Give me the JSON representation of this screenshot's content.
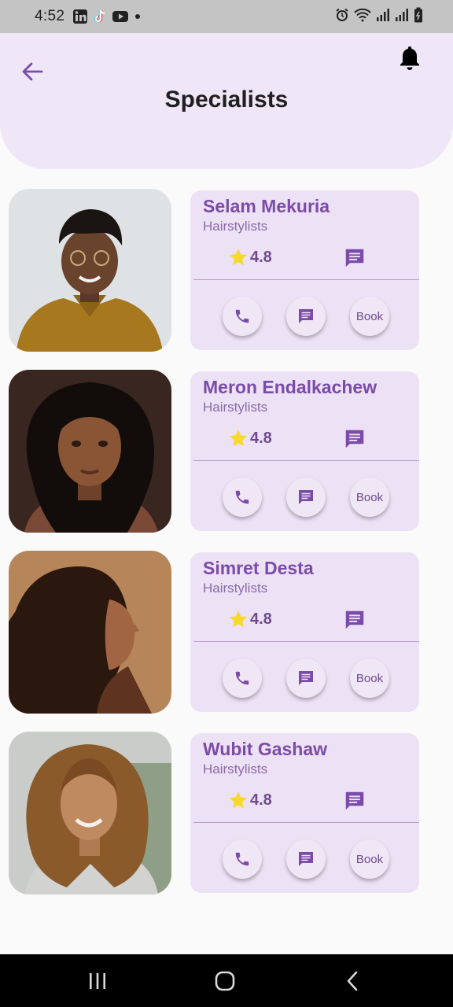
{
  "status_bar": {
    "time": "4:52",
    "left_icons": [
      "linkedin-icon",
      "tiktok-icon",
      "youtube-icon",
      "dot-icon"
    ],
    "right_icons": [
      "alarm-icon",
      "wifi-icon",
      "signal-icon",
      "signal-icon",
      "battery-icon"
    ]
  },
  "header": {
    "title": "Specialists",
    "back_icon": "arrow-left-icon",
    "notifications_icon": "bell-icon"
  },
  "specialists": [
    {
      "name": "Selam Mekuria",
      "role": "Hairstylists",
      "rating": "4.8",
      "book_label": "Book"
    },
    {
      "name": "Meron Endalkachew",
      "role": "Hairstylists",
      "rating": "4.8",
      "book_label": "Book"
    },
    {
      "name": "Simret Desta",
      "role": "Hairstylists",
      "rating": "4.8",
      "book_label": "Book"
    },
    {
      "name": "Wubit Gashaw",
      "role": "Hairstylists",
      "rating": "4.8",
      "book_label": "Book"
    }
  ],
  "colors": {
    "accent": "#7a4ba8",
    "header_bg": "#efe6f7",
    "card_bg": "#ece1f5",
    "star": "#f6d92b"
  },
  "nav_bar": {
    "icons": [
      "recent-apps-icon",
      "home-icon",
      "back-icon"
    ]
  }
}
